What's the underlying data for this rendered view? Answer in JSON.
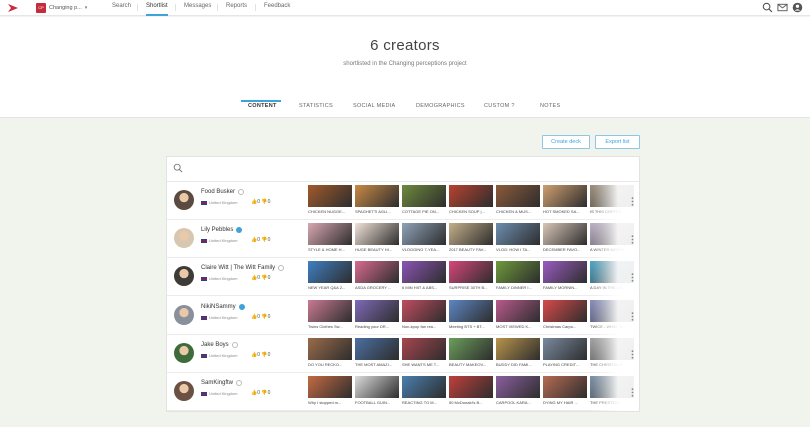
{
  "nav": {
    "project_badge": "CP",
    "project_name": "Changing p...",
    "items": [
      "Search",
      "Shortlist",
      "Messages",
      "Reports",
      "Feedback"
    ],
    "active": "Shortlist",
    "accent": "#3ea3d6",
    "icons": [
      "search-icon",
      "mail-icon",
      "user-icon"
    ]
  },
  "header": {
    "title": "6 creators",
    "subtitle": "shortlisted in the Changing perceptions project"
  },
  "tabs": [
    "CONTENT",
    "STATISTICS",
    "SOCIAL MEDIA",
    "DEMOGRAPHICS",
    "CUSTOM",
    "NOTES"
  ],
  "custom_tab_icon": "?",
  "actions": {
    "create_deck": "Create deck",
    "export_list": "Export list"
  },
  "creators": [
    {
      "name": "Food Busker",
      "verified": false,
      "country": "United Kingdom",
      "likes": "0",
      "dislikes": "0",
      "videos": [
        "CHICKEN NUGGE...",
        "SPAGHETTI AGLI...",
        "COTTAGE PIE ON...",
        "CHICKEN SOUP |...",
        "CHICKEN & MUS...",
        "HOT SMOKED SA...",
        "IS THIS COFFEE..."
      ]
    },
    {
      "name": "Lily Pebbles",
      "verified": true,
      "country": "United Kingdom",
      "likes": "0",
      "dislikes": "0",
      "videos": [
        "STYLE & HOME H...",
        "HUGE BEAUTY HI...",
        "VLOGGING 7-YEA...",
        "2017 BEAUTY FAV...",
        "VLOG: HOW I TA...",
        "DECEMBER FAVO...",
        "A WINTER MORNI..."
      ]
    },
    {
      "name": "Claire Witt | The Witt Family",
      "verified": false,
      "country": "United Kingdom",
      "likes": "0",
      "dislikes": "0",
      "videos": [
        "NEW YEAR Q&A 2...",
        "ASDA GROCERY ...",
        "6 MIN HIIT & ABS...",
        "SURPRISE 30TH B...",
        "FAMILY DINNER I...",
        "FAMILY MORNIN...",
        "A DAY IN THE LIF..."
      ]
    },
    {
      "name": "NikiNSammy",
      "verified": true,
      "country": "United Kingdom",
      "likes": "0",
      "dislikes": "0",
      "videos": [
        "Twins Clothes Sw...",
        "Reading your DR...",
        "Non-kpop fan rea...",
        "Meeting BTS + BT...",
        "MOST VIEWED K...",
        "Christmas Carpo...",
        "TWICE - WHAT IS..."
      ]
    },
    {
      "name": "Jake Boys",
      "verified": false,
      "country": "United Kingdom",
      "likes": "0",
      "dislikes": "0",
      "videos": [
        "DO YOU RECKO...",
        "THE MOST AMAZI...",
        "SHE WANTS ME T...",
        "BEAUTY MAKEOV...",
        "BUDDY DID FAMI...",
        "PLAYING CREDIT...",
        "THE CHRISTMAS ..."
      ]
    },
    {
      "name": "SamKingftw",
      "verified": false,
      "country": "United Kingdom",
      "likes": "0",
      "dislikes": "0",
      "videos": [
        "Why I stopped m...",
        "FOOTBALL GUIN...",
        "REACTING TO M...",
        "50 McDonald's B...",
        "CARPOOL KARA...",
        "DYING MY HAIR ...",
        "THE PRESTIGE ..."
      ]
    }
  ]
}
